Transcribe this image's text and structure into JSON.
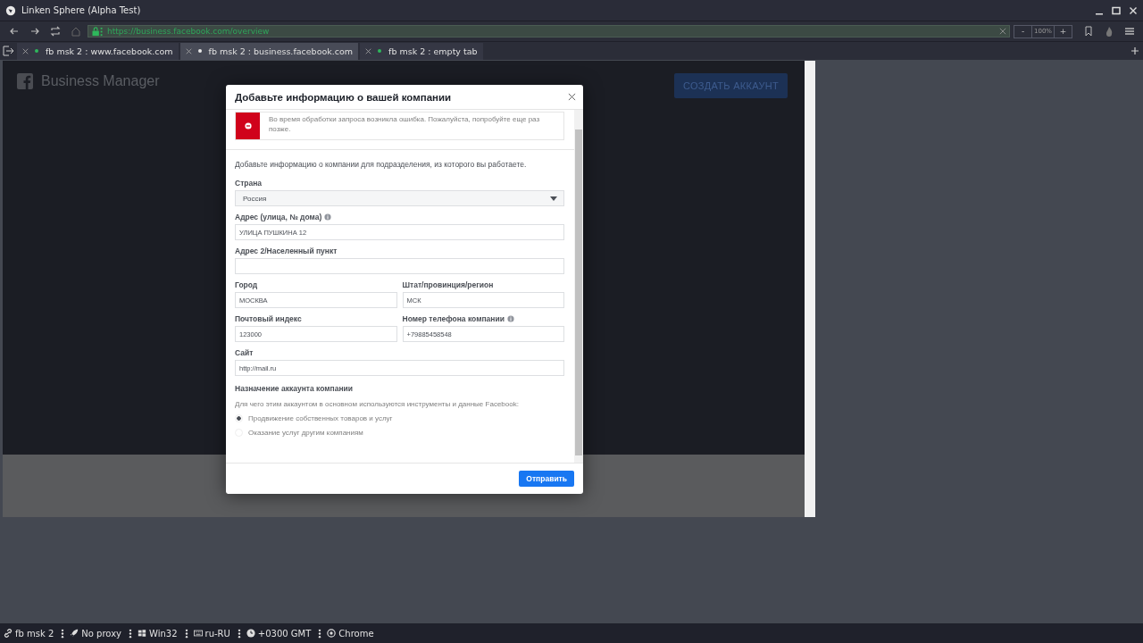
{
  "window": {
    "title": "Linken Sphere (Alpha Test)"
  },
  "address_bar": {
    "url": "https://business.facebook.com/overview",
    "zoom_out": "-",
    "zoom": "100%",
    "zoom_in": "+"
  },
  "tabs": [
    {
      "label": "fb msk 2 : www.facebook.com",
      "selected": false
    },
    {
      "label": "fb msk 2 : business.facebook.com",
      "selected": true
    },
    {
      "label": "fb msk 2 : empty tab",
      "selected": false
    }
  ],
  "page": {
    "brand": "Business Manager",
    "create_button": "СОЗДАТЬ АККАУНТ"
  },
  "dialog": {
    "title": "Добавьте информацию о вашей компании",
    "error": "Во время обработки запроса возникла ошибка. Пожалуйста, попробуйте еще раз позже.",
    "intro": "Добавьте информацию о компании для подразделения, из которого вы работаете.",
    "fields": [
      {
        "kind": "select",
        "label": "Страна",
        "value": "Россия",
        "info": false
      },
      {
        "kind": "wide",
        "label": "Адрес (улица, № дома)",
        "value": "УЛИЦА ПУШКИНА 12",
        "info": true
      },
      {
        "kind": "wide",
        "label": "Адрес 2/Населенный пункт",
        "info": false
      },
      {
        "kind": "half",
        "label": "Город",
        "value": "МОСКВА",
        "info": false
      },
      {
        "kind": "half",
        "label": "Штат/провинция/регион",
        "value": "МСК",
        "info": false
      },
      {
        "kind": "half",
        "label": "Почтовый индекс",
        "value": "123000",
        "info": false
      },
      {
        "kind": "half",
        "label": "Номер телефона компании",
        "value": "+79885458548",
        "info": true
      },
      {
        "kind": "wide",
        "label": "Сайт",
        "value": "http://mail.ru",
        "info": false
      }
    ],
    "purpose": {
      "heading": "Назначение аккаунта компании",
      "question": "Для чего этим аккаунтом в основном используются инструменты и данные Facebook:",
      "options": [
        {
          "label": "Продвижение собственных товаров и услуг",
          "selected": true
        },
        {
          "label": "Оказание услуг другим компаниям",
          "selected": false
        }
      ]
    },
    "submit": "Отправить"
  },
  "status_bar": [
    {
      "kind": "link",
      "text": "fb msk 2"
    },
    {
      "kind": "proxy",
      "text": "No proxy"
    },
    {
      "kind": "os",
      "text": "Win32"
    },
    {
      "kind": "language",
      "text": "ru-RU"
    },
    {
      "kind": "timezone",
      "text": "+0300 GMT"
    },
    {
      "kind": "browser",
      "text": "Chrome"
    }
  ]
}
